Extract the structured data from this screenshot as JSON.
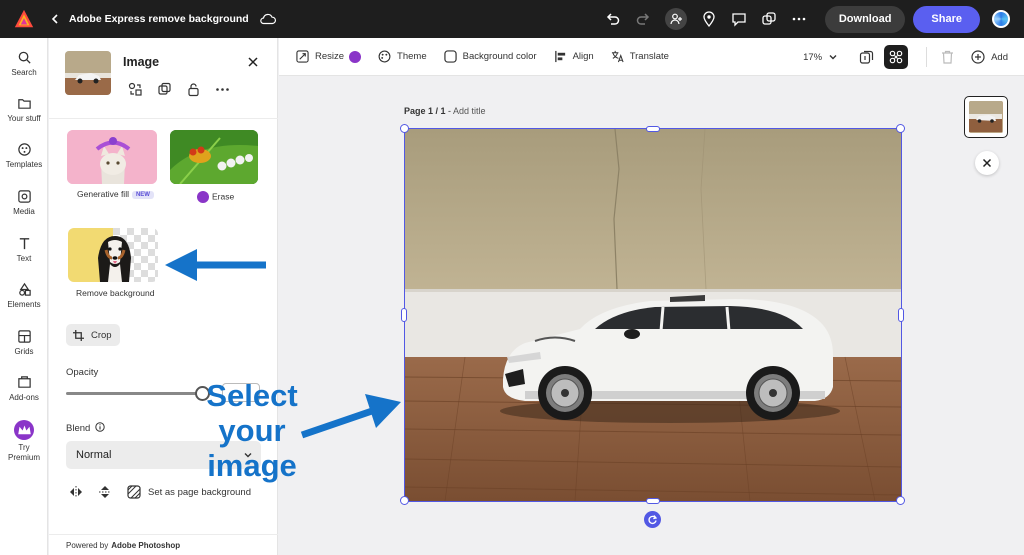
{
  "topbar": {
    "doc_title": "Adobe Express remove background",
    "download_label": "Download",
    "share_label": "Share",
    "icons": [
      "adobe-express-logo",
      "back-chevron",
      "cloud-sync",
      "undo",
      "redo",
      "invite-user",
      "location-pin",
      "comment",
      "duplicate",
      "more-horizontal",
      "user-avatar"
    ]
  },
  "rail": {
    "items": [
      {
        "label": "Search",
        "icon": "search-icon"
      },
      {
        "label": "Your stuff",
        "icon": "folder-icon"
      },
      {
        "label": "Templates",
        "icon": "templates-icon"
      },
      {
        "label": "Media",
        "icon": "media-icon"
      },
      {
        "label": "Text",
        "icon": "text-icon"
      },
      {
        "label": "Elements",
        "icon": "elements-icon"
      },
      {
        "label": "Grids",
        "icon": "grids-icon"
      },
      {
        "label": "Add-ons",
        "icon": "addons-icon"
      },
      {
        "label": "Try\nPremium",
        "icon": "crown-icon"
      }
    ]
  },
  "panel": {
    "title": "Image",
    "tools": {
      "generative_fill": "Generative fill",
      "new_badge": "NEW",
      "erase": "Erase",
      "remove_background": "Remove background"
    },
    "crop_label": "Crop",
    "opacity_label": "Opacity",
    "opacity_value": 1.0,
    "blend_label": "Blend",
    "blend_value": "Normal",
    "page_background_label": "Set as page background",
    "powered_prefix": "Powered by",
    "powered_brand": "Adobe Photoshop"
  },
  "toolbar2": {
    "resize": "Resize",
    "theme": "Theme",
    "background_color": "Background color",
    "align": "Align",
    "translate": "Translate",
    "zoom": "17%",
    "add": "Add"
  },
  "canvas": {
    "page_label": "Page 1 / 1",
    "page_sep": " - ",
    "add_title": "Add title"
  },
  "annotation": {
    "line1": "Select",
    "line2": "your",
    "line3": "image",
    "color": "#1573c9"
  },
  "colors": {
    "accent": "#5258e4",
    "share": "#5a5ff0",
    "premium": "#8a35c8",
    "annotation": "#1573c9"
  }
}
